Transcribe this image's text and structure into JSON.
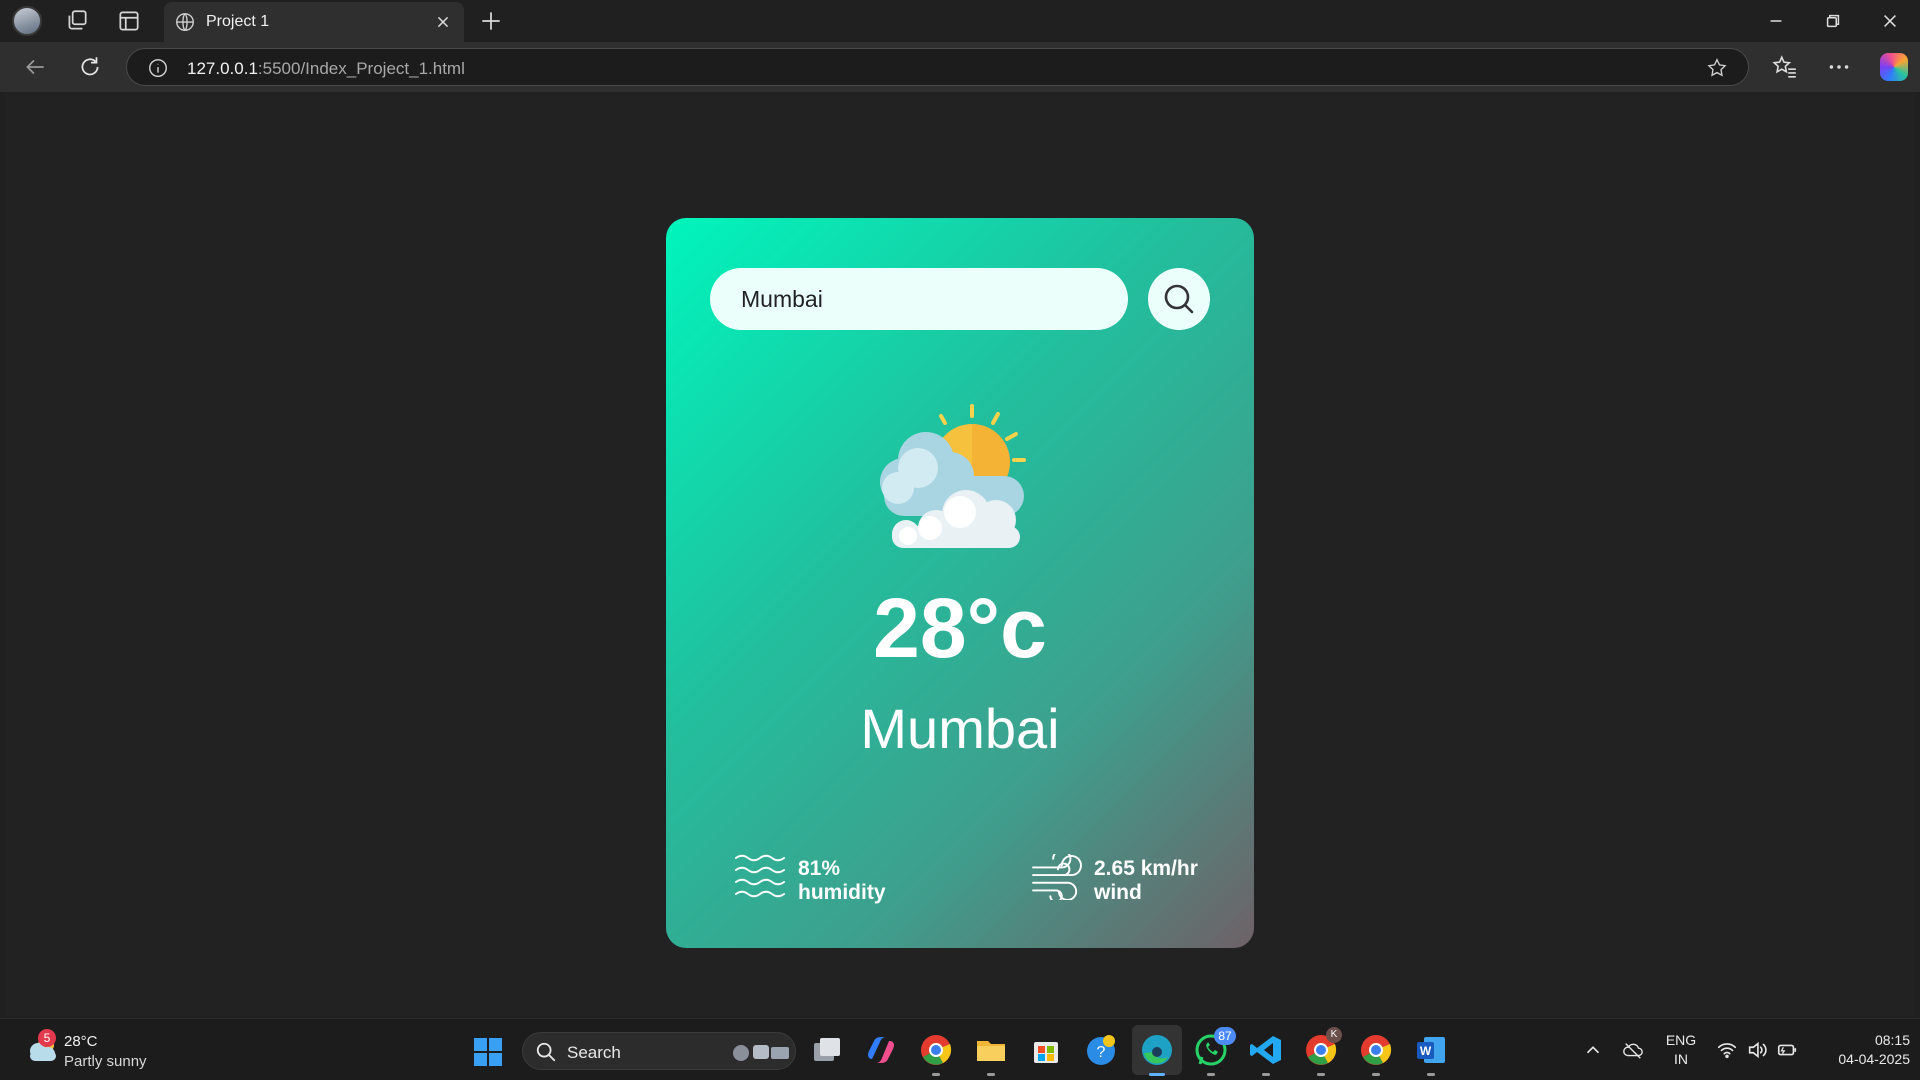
{
  "browser": {
    "tab_title": "Project 1",
    "url_host": "127.0.0.1",
    "url_path": ":5500/Index_Project_1.html"
  },
  "weather_app": {
    "search_value": "Mumbai",
    "temperature": "28°c",
    "city": "Mumbai",
    "humidity_value": "81%",
    "humidity_label": "humidity",
    "wind_value": "2.65 km/hr",
    "wind_label": "wind",
    "weather_icon": "partly-cloudy-icon",
    "gradient_colors": [
      "#00f5bd",
      "#22be9d",
      "#3e9f8d",
      "#6e6167"
    ]
  },
  "taskbar": {
    "weather_badge": "5",
    "weather_temp": "28°C",
    "weather_desc": "Partly sunny",
    "search_label": "Search",
    "whatsapp_badge": "87",
    "chrome_profile_badge": "K",
    "language": "ENG",
    "region": "IN",
    "time": "08:15",
    "date": "04-04-2025"
  }
}
